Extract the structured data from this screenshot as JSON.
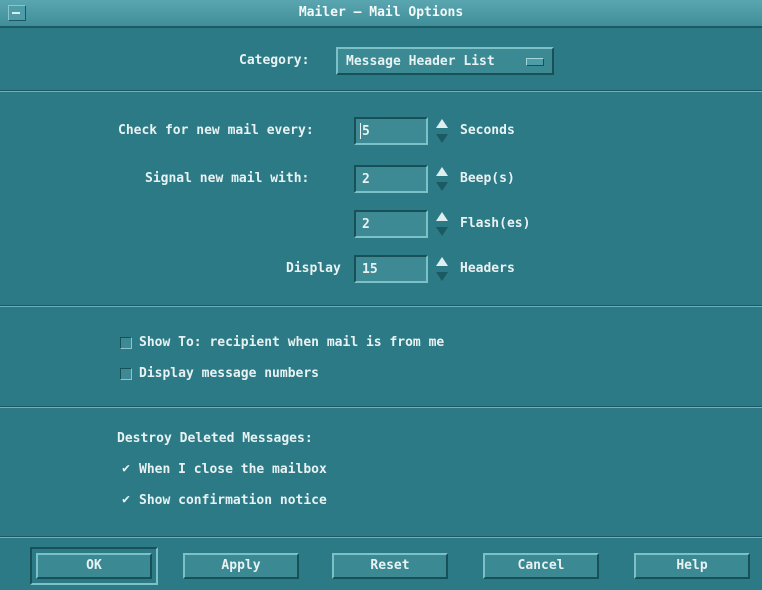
{
  "window": {
    "title": "Mailer – Mail Options"
  },
  "category": {
    "label": "Category:",
    "value": "Message Header List"
  },
  "check_interval": {
    "label": "Check for new mail every:",
    "value": "5",
    "unit": "Seconds"
  },
  "signal": {
    "label": "Signal new mail with:",
    "beep_value": "2",
    "beep_unit": "Beep(s)",
    "flash_value": "2",
    "flash_unit": "Flash(es)"
  },
  "display_headers": {
    "label": "Display",
    "value": "15",
    "unit": "Headers"
  },
  "options": {
    "show_to": {
      "label": "Show To: recipient when mail is from me",
      "checked": false
    },
    "display_numbers": {
      "label": "Display message numbers",
      "checked": false
    }
  },
  "destroy": {
    "heading": "Destroy Deleted Messages:",
    "check_mark": "✔",
    "on_close": {
      "label": "When I close the mailbox",
      "checked": true
    },
    "confirm": {
      "label": "Show confirmation notice",
      "checked": true
    }
  },
  "buttons": {
    "ok": "OK",
    "apply": "Apply",
    "reset": "Reset",
    "cancel": "Cancel",
    "help": "Help"
  },
  "colors": {
    "background": "#2c7a86",
    "title_bar": "#4a98a3",
    "text": "#e8f2f2"
  }
}
